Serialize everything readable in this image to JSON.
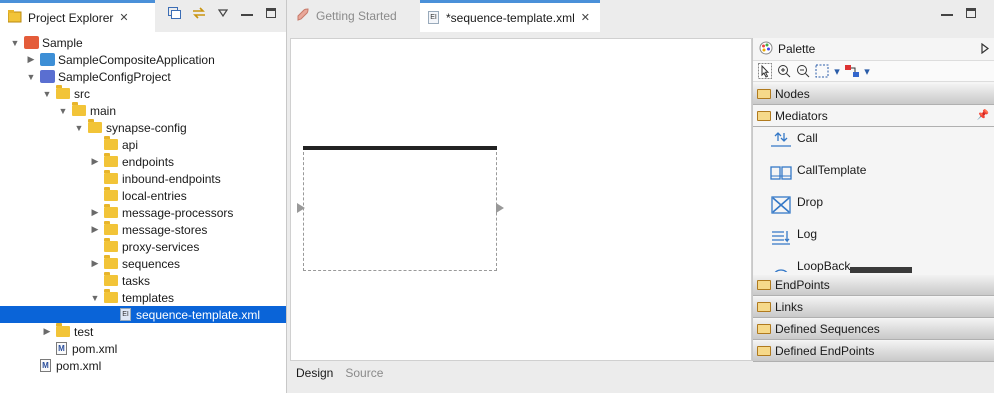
{
  "explorer": {
    "title": "Project Explorer",
    "tree": [
      {
        "label": "Sample",
        "depth": 0,
        "icon": "project-sample-icon",
        "twisty": "open"
      },
      {
        "label": "SampleCompositeApplication",
        "depth": 1,
        "icon": "project-composite-icon",
        "twisty": "closed"
      },
      {
        "label": "SampleConfigProject",
        "depth": 1,
        "icon": "project-config-icon",
        "twisty": "open"
      },
      {
        "label": "src",
        "depth": 2,
        "icon": "folder-icon",
        "twisty": "open"
      },
      {
        "label": "main",
        "depth": 3,
        "icon": "folder-icon",
        "twisty": "open"
      },
      {
        "label": "synapse-config",
        "depth": 4,
        "icon": "folder-icon",
        "twisty": "open"
      },
      {
        "label": "api",
        "depth": 5,
        "icon": "folder-icon",
        "twisty": "none"
      },
      {
        "label": "endpoints",
        "depth": 5,
        "icon": "folder-icon",
        "twisty": "closed"
      },
      {
        "label": "inbound-endpoints",
        "depth": 5,
        "icon": "folder-icon",
        "twisty": "none"
      },
      {
        "label": "local-entries",
        "depth": 5,
        "icon": "folder-icon",
        "twisty": "none"
      },
      {
        "label": "message-processors",
        "depth": 5,
        "icon": "folder-icon",
        "twisty": "closed"
      },
      {
        "label": "message-stores",
        "depth": 5,
        "icon": "folder-icon",
        "twisty": "closed"
      },
      {
        "label": "proxy-services",
        "depth": 5,
        "icon": "folder-icon",
        "twisty": "none"
      },
      {
        "label": "sequences",
        "depth": 5,
        "icon": "folder-icon",
        "twisty": "closed"
      },
      {
        "label": "tasks",
        "depth": 5,
        "icon": "folder-icon",
        "twisty": "none"
      },
      {
        "label": "templates",
        "depth": 5,
        "icon": "folder-icon",
        "twisty": "open"
      },
      {
        "label": "sequence-template.xml",
        "depth": 6,
        "icon": "xml-file-icon",
        "twisty": "none",
        "selected": true
      },
      {
        "label": "test",
        "depth": 2,
        "icon": "folder-icon",
        "twisty": "closed"
      },
      {
        "label": "pom.xml",
        "depth": 2,
        "icon": "maven-file-icon",
        "twisty": "none"
      },
      {
        "label": "pom.xml",
        "depth": 1,
        "icon": "maven-file-icon",
        "twisty": "none"
      }
    ]
  },
  "editor": {
    "tabs": [
      {
        "label": "Getting Started",
        "active": false
      },
      {
        "label": "*sequence-template.xml",
        "active": true
      }
    ],
    "bottom_tabs": [
      "Design",
      "Source"
    ]
  },
  "palette": {
    "title": "Palette",
    "drawers": {
      "nodes": "Nodes",
      "mediators": "Mediators",
      "endpoints": "EndPoints",
      "links": "Links",
      "defined_sequences": "Defined Sequences",
      "defined_endpoints": "Defined EndPoints"
    },
    "mediators": [
      "Call",
      "CallTemplate",
      "Drop",
      "Log",
      "LoopBack"
    ]
  },
  "colors": {
    "selection": "#0a64d8",
    "tab_accent": "#4a90d9",
    "folder": "#f2c438"
  }
}
